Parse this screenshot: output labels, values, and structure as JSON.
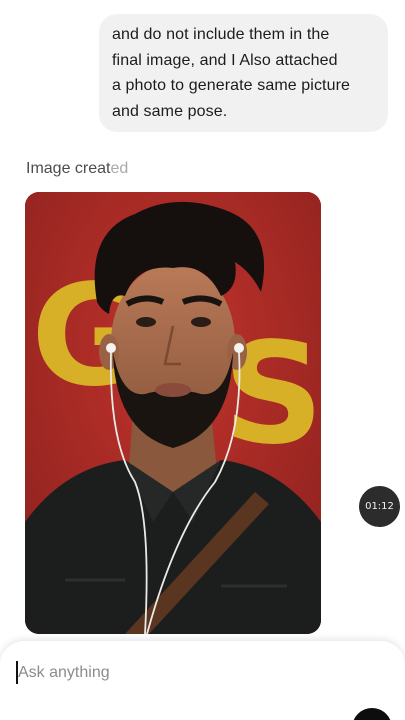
{
  "conversation": {
    "user_message_lines": [
      "and do not include them in the",
      "final image, and I Also attached",
      "a photo to generate same picture",
      "and same pose."
    ],
    "status_main": "Image creat",
    "status_fade": "ed",
    "image_label": "G S",
    "timer": "01:12"
  },
  "composer": {
    "placeholder": "Ask anything"
  },
  "colors": {
    "backdrop_red": "#a82a26",
    "letter_yellow": "#d8b027",
    "shirt": "#1c1e1d",
    "bubble": "#f1f1f1"
  },
  "icons": {
    "send": "send-button-icon"
  }
}
